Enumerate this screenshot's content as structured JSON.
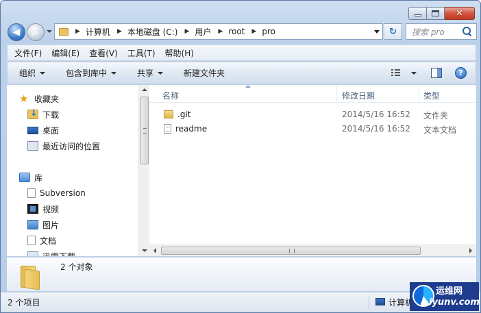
{
  "window": {
    "caption_close": "✕"
  },
  "nav": {
    "back_glyph": "◀",
    "forward_glyph": "▶"
  },
  "address": {
    "crumbs": [
      "计算机",
      "本地磁盘 (C:)",
      "用户",
      "root",
      "pro"
    ],
    "refresh_glyph": "↻"
  },
  "search": {
    "placeholder": "搜索 pro"
  },
  "menubar": {
    "items": [
      "文件(F)",
      "编辑(E)",
      "查看(V)",
      "工具(T)",
      "帮助(H)"
    ]
  },
  "commandbar": {
    "organize": "组织",
    "include_in_library": "包含到库中",
    "share": "共享",
    "new_folder": "新建文件夹",
    "help_glyph": "?"
  },
  "navpane": {
    "favorites": "收藏夹",
    "downloads": "下载",
    "desktop": "桌面",
    "recent": "最近访问的位置",
    "libraries": "库",
    "subversion": "Subversion",
    "videos": "视频",
    "pictures": "图片",
    "documents": "文档",
    "thunder": "迅雷下载"
  },
  "columns": {
    "name": "名称",
    "date": "修改日期",
    "type": "类型"
  },
  "files": [
    {
      "name": ".git",
      "date": "2014/5/16 16:52",
      "type": "文件夹",
      "icon": "folder-icon"
    },
    {
      "name": "readme",
      "date": "2014/5/16 16:52",
      "type": "文本文档",
      "icon": "text-file-icon"
    }
  ],
  "details": {
    "count_text": "2 个对象"
  },
  "statusbar": {
    "items_text": "2 个项目",
    "location_text": "计算机"
  },
  "watermark": {
    "title": "运维网",
    "subtitle": "iyunv.com"
  }
}
